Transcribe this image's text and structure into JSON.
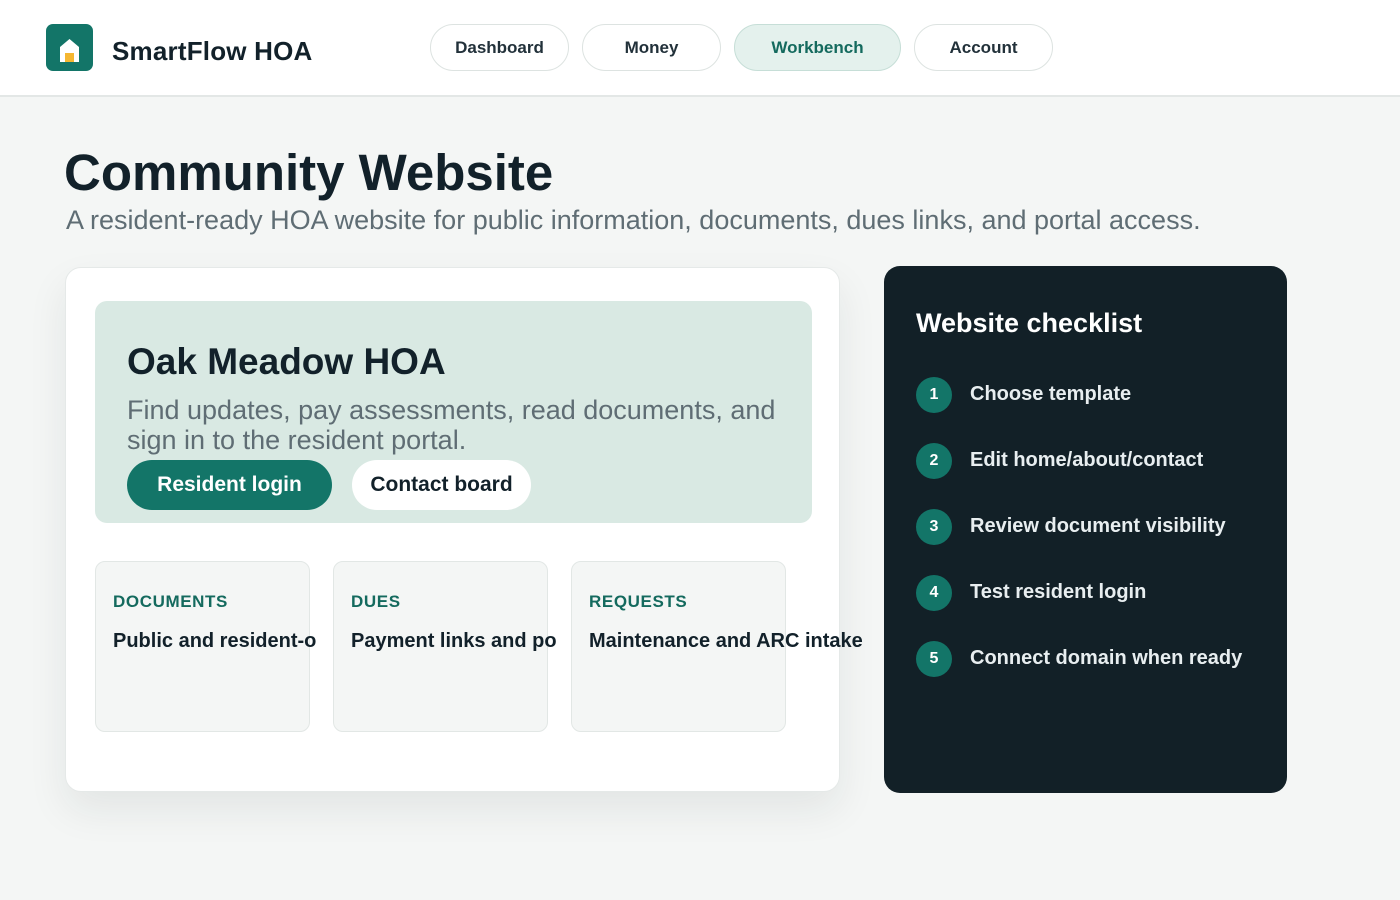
{
  "header": {
    "brand": "SmartFlow HOA",
    "logo_icon": "house-icon",
    "nav": [
      {
        "label": "Dashboard",
        "active": false
      },
      {
        "label": "Money",
        "active": false
      },
      {
        "label": "Workbench",
        "active": true
      },
      {
        "label": "Account",
        "active": false
      }
    ]
  },
  "page": {
    "title": "Community Website",
    "subtitle": "A resident-ready HOA website for public information, documents, dues links, and portal access."
  },
  "preview": {
    "hero": {
      "title": "Oak Meadow HOA",
      "description": "Find updates, pay assessments, read documents, and sign in to the resident portal.",
      "primary_button": "Resident login",
      "secondary_button": "Contact board"
    },
    "features": [
      {
        "label": "DOCUMENTS",
        "text": "Public and resident-o"
      },
      {
        "label": "DUES",
        "text": "Payment links and po"
      },
      {
        "label": "REQUESTS",
        "text": "Maintenance and ARC intake"
      }
    ]
  },
  "checklist": {
    "title": "Website checklist",
    "items": [
      {
        "num": "1",
        "label": "Choose template"
      },
      {
        "num": "2",
        "label": "Edit home/about/contact"
      },
      {
        "num": "3",
        "label": "Review document visibility"
      },
      {
        "num": "4",
        "label": "Test resident login"
      },
      {
        "num": "5",
        "label": "Connect domain when ready"
      }
    ]
  },
  "colors": {
    "accent": "#137568",
    "accent_light": "#d9e9e3",
    "dark_panel": "#122027",
    "logo_door": "#f5b731"
  }
}
